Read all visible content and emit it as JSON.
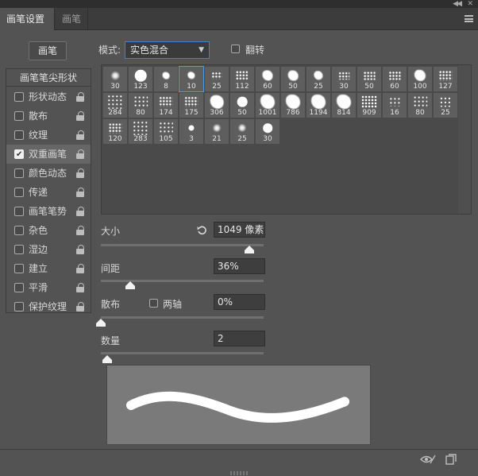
{
  "tabs": [
    "画笔设置",
    "画笔"
  ],
  "preset_button": "画笔",
  "sidebar": {
    "header": "画笔笔尖形状",
    "items": [
      {
        "label": "形状动态",
        "checked": false
      },
      {
        "label": "散布",
        "checked": false
      },
      {
        "label": "纹理",
        "checked": false
      },
      {
        "label": "双重画笔",
        "checked": true
      },
      {
        "label": "颜色动态",
        "checked": false
      },
      {
        "label": "传递",
        "checked": false
      },
      {
        "label": "画笔笔势",
        "checked": false
      },
      {
        "label": "杂色",
        "checked": false
      },
      {
        "label": "湿边",
        "checked": false
      },
      {
        "label": "建立",
        "checked": false
      },
      {
        "label": "平滑",
        "checked": false
      },
      {
        "label": "保护纹理",
        "checked": false
      }
    ]
  },
  "mode": {
    "label": "模式:",
    "value": "实色混合"
  },
  "flip": {
    "label": "翻转",
    "checked": false
  },
  "brushes": [
    {
      "size": "30",
      "style": "soft"
    },
    {
      "size": "123",
      "style": "hard"
    },
    {
      "size": "8",
      "style": "splat"
    },
    {
      "size": "10",
      "style": "splat"
    },
    {
      "size": "25",
      "style": "spray"
    },
    {
      "size": "112",
      "style": "spray"
    },
    {
      "size": "60",
      "style": "splat"
    },
    {
      "size": "50",
      "style": "splat"
    },
    {
      "size": "25",
      "style": "splat"
    },
    {
      "size": "30",
      "style": "spray"
    },
    {
      "size": "50",
      "style": "spray"
    },
    {
      "size": "60",
      "style": "spray"
    },
    {
      "size": "100",
      "style": "splat"
    },
    {
      "size": "127",
      "style": "spray"
    },
    {
      "size": "284",
      "style": "dots"
    },
    {
      "size": "80",
      "style": "dots"
    },
    {
      "size": "174",
      "style": "spray"
    },
    {
      "size": "175",
      "style": "spray"
    },
    {
      "size": "306",
      "style": "splat"
    },
    {
      "size": "50",
      "style": "hard"
    },
    {
      "size": "1001",
      "style": "splat"
    },
    {
      "size": "786",
      "style": "splat"
    },
    {
      "size": "1194",
      "style": "splat"
    },
    {
      "size": "814",
      "style": "splat"
    },
    {
      "size": "909",
      "style": "spray"
    },
    {
      "size": "16",
      "style": "dots"
    },
    {
      "size": "80",
      "style": "dots"
    },
    {
      "size": "25",
      "style": "dots"
    },
    {
      "size": "120",
      "style": "spray"
    },
    {
      "size": "283",
      "style": "dots"
    },
    {
      "size": "105",
      "style": "dots"
    },
    {
      "size": "3",
      "style": "hard"
    },
    {
      "size": "21",
      "style": "soft"
    },
    {
      "size": "25",
      "style": "soft"
    },
    {
      "size": "30",
      "style": "hard"
    }
  ],
  "selected_brush_index": 3,
  "size": {
    "label": "大小",
    "value": "1049 像素",
    "slider": 0.91
  },
  "spacing": {
    "label": "间距",
    "value": "36%",
    "slider": 0.18
  },
  "scatter": {
    "label": "散布",
    "both_axes_label": "两轴",
    "both_axes_checked": false,
    "value": "0%",
    "slider": 0.0
  },
  "count": {
    "label": "数量",
    "value": "2",
    "slider": 0.04
  },
  "colors": {
    "accent": "#4d9be6",
    "panel": "#535353",
    "preview_bg": "#7a7a7a"
  }
}
